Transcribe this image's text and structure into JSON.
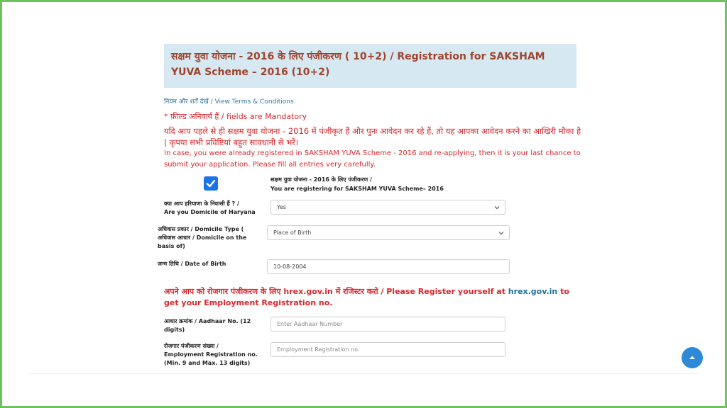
{
  "header": {
    "title": "सक्षम युवा योजना - 2016 के लिए पंजीकरण ( 10+2) / Registration for SAKSHAM YUVA Scheme – 2016 (10+2)"
  },
  "terms": {
    "hindi": "नियम और शर्तें देखें",
    "separator": " / ",
    "english": "View Terms & Conditions"
  },
  "mandatory_note": "* फ़ील्ड अनिवार्य हैं / fields are Mandatory",
  "warning": {
    "hindi": "यदि आप पहले से ही सक्षम युवा योजना - 2016 में पंजीकृत हैं और पुनः आवेदन कर रहे हैं, तो यह आपका आवेदन करने का आखिरी मौका है | कृपया सभी प्रविष्टियां बहुत सावधानी से भरें।",
    "english": "In case, you were already registered in SAKSHAM YUVA Scheme - 2016 and re-applying, then it is your last chance to submit your application. Please fill all entries very carefully."
  },
  "registration": {
    "checked": true,
    "label_hi": "सक्षम युवा योजना - 2016 के लिए पंजीकरण /",
    "label_en": "You are registering for SAKSHAM YUVA Scheme– 2016"
  },
  "fields": {
    "domicile": {
      "label_hi": "क्या आप हरियाणा के निवासी हैं ? /",
      "label_en": "Are you Domicile of Haryana",
      "value": "Yes"
    },
    "domicile_type": {
      "label_1": "अधिवास प्रकार / Domicile Type (",
      "label_2": "अधिवास आधार / Domicile on the",
      "label_3": "basis of)",
      "value": "Place of Birth"
    },
    "dob": {
      "label": "जन्म तिथि / Date of Birth",
      "value": "10-08-2004"
    },
    "aadhaar": {
      "label_1": "आधार क्रमांक / Aadhaar No. (12",
      "label_2": "digits)",
      "placeholder": "Enter Aadhaar Number"
    },
    "employment": {
      "label_1": "रोजगार पंजीकरण संख्या /",
      "label_2": "Employment Registration no.",
      "label_3": "(Min. 9 and Max. 13 digits)",
      "placeholder": "Employment Registration no."
    }
  },
  "employment_notice": {
    "part1": "अपने आप को रोजगार पंजीकरण के लिए hrex.gov.in में रजिस्टर करो / Please Register yourself at ",
    "link": "hrex.gov.in",
    "part2": " to get your Employment Registration no."
  },
  "colors": {
    "title_bg": "#d6e9f3",
    "title_text": "#a0432c",
    "warning_red": "#d9262c",
    "link_blue": "#2d7aa0",
    "checkbox_blue": "#1a73e8",
    "frame_green": "#6cc45a"
  },
  "icons": {
    "checkbox": "check-icon",
    "select": "chevron-down-icon",
    "scroll": "arrow-up-icon"
  }
}
